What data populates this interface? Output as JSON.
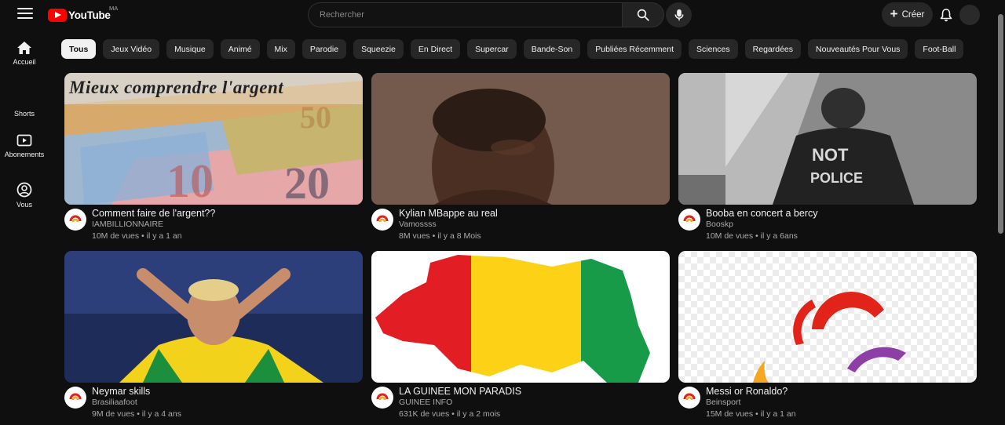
{
  "header": {
    "logo_text": "YouTube",
    "logo_region": "MA",
    "search_placeholder": "Rechercher",
    "create_label": "Créer"
  },
  "sidebar": {
    "items": [
      {
        "label": "Accueil",
        "icon": "home-icon"
      },
      {
        "label": "Shorts",
        "icon": "shorts-icon"
      },
      {
        "label": "Abonements",
        "icon": "subscriptions-icon"
      },
      {
        "label": "Vous",
        "icon": "you-icon"
      }
    ]
  },
  "chips": [
    "Tous",
    "Jeux Vidéo",
    "Musique",
    "Animé",
    "Mix",
    "Parodie",
    "Squeezie",
    "En Direct",
    "Supercar",
    "Bande-Son",
    "Publiées Récemment",
    "Sciences",
    "Regardées",
    "Nouveautés Pour Vous",
    "Foot-Ball"
  ],
  "videos": [
    {
      "title": "Comment faire de l'argent??",
      "channel": "IAMBILLIONNAIRE",
      "stats": "10M de vues • il y a 1 an",
      "thumb_text": "Mieux comprendre l'argent"
    },
    {
      "title": "Kylian MBappe au real",
      "channel": "Vamossss",
      "stats": "8M vues • il y a 8 Mois"
    },
    {
      "title": "Booba en concert a bercy",
      "channel": "Booskp",
      "stats": "10M de vues • il y a 6ans"
    },
    {
      "title": "Neymar skills",
      "channel": "Brasiliaafoot",
      "stats": "9M de vues • il y a 4 ans"
    },
    {
      "title": "LA GUINEE MON PARADIS",
      "channel": "GUINEE INFO",
      "stats": "631K de vues • il y a 2 mois"
    },
    {
      "title": "Messi or Ronaldo?",
      "channel": "Beinsport",
      "stats": "15M de vues • il y a 1 an"
    }
  ],
  "colors": {
    "accent": "#ff0000",
    "background": "#0f0f0f",
    "chip": "#272727"
  }
}
